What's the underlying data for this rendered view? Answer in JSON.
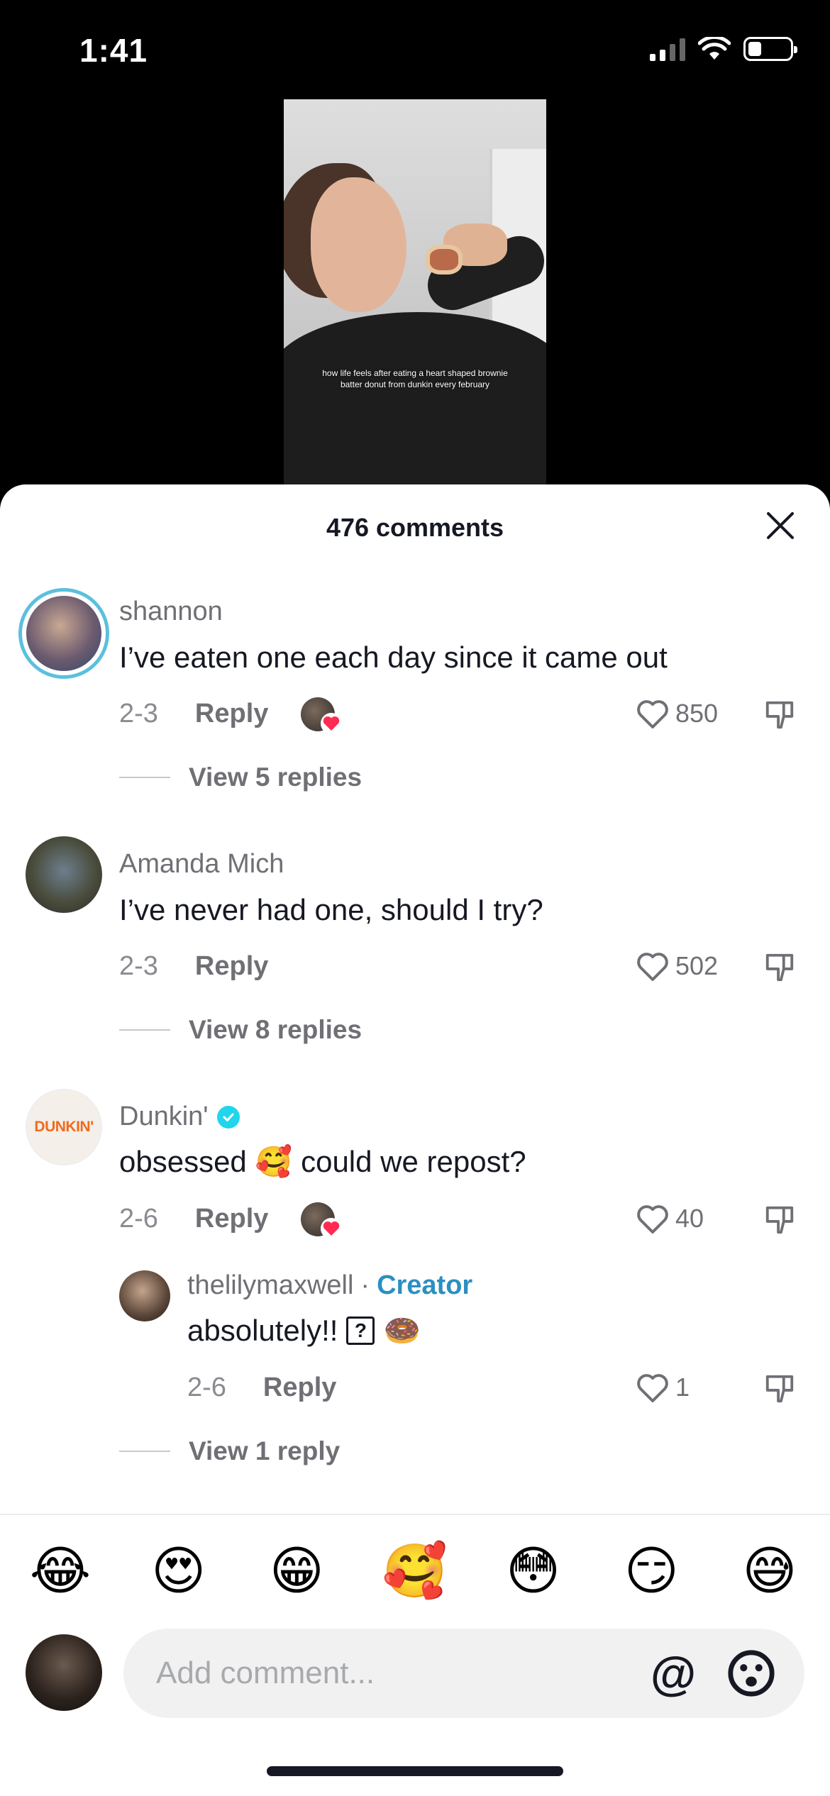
{
  "status_bar": {
    "time": "1:41"
  },
  "video": {
    "caption": "how life feels after eating a heart shaped brownie batter donut from dunkin every february"
  },
  "sheet": {
    "title": "476 comments"
  },
  "comments": [
    {
      "username": "shannon",
      "text": "I’ve eaten one each day since it came out",
      "date": "2-3",
      "reply_label": "Reply",
      "likes": "850",
      "view_replies": "View 5 replies"
    },
    {
      "username": "Amanda Mich",
      "text": "I’ve never had one, should I try?",
      "date": "2-3",
      "reply_label": "Reply",
      "likes": "502",
      "view_replies": "View 8 replies"
    },
    {
      "username": "Dunkin'",
      "avatar_text": "DUNKIN'",
      "text_before": "obsessed",
      "emoji": "🥰",
      "text_after": "could we repost?",
      "date": "2-6",
      "reply_label": "Reply",
      "likes": "40",
      "view_replies": "View 1 reply",
      "reply": {
        "username": "thelilymaxwell",
        "separator": "·",
        "creator_label": "Creator",
        "text": "absolutely!!",
        "box_glyph": "?",
        "emoji": "🍩",
        "date": "2-6",
        "reply_label": "Reply",
        "likes": "1"
      }
    }
  ],
  "emoji_bar": [
    "😂",
    "😍",
    "😁",
    "🥰",
    "😳",
    "😏",
    "😅"
  ],
  "composer": {
    "placeholder": "Add comment...",
    "at_symbol": "@"
  },
  "colors": {
    "accent_verified": "#20d5ec",
    "creator": "#2c8fc2",
    "heart_red": "#fe2c55"
  }
}
